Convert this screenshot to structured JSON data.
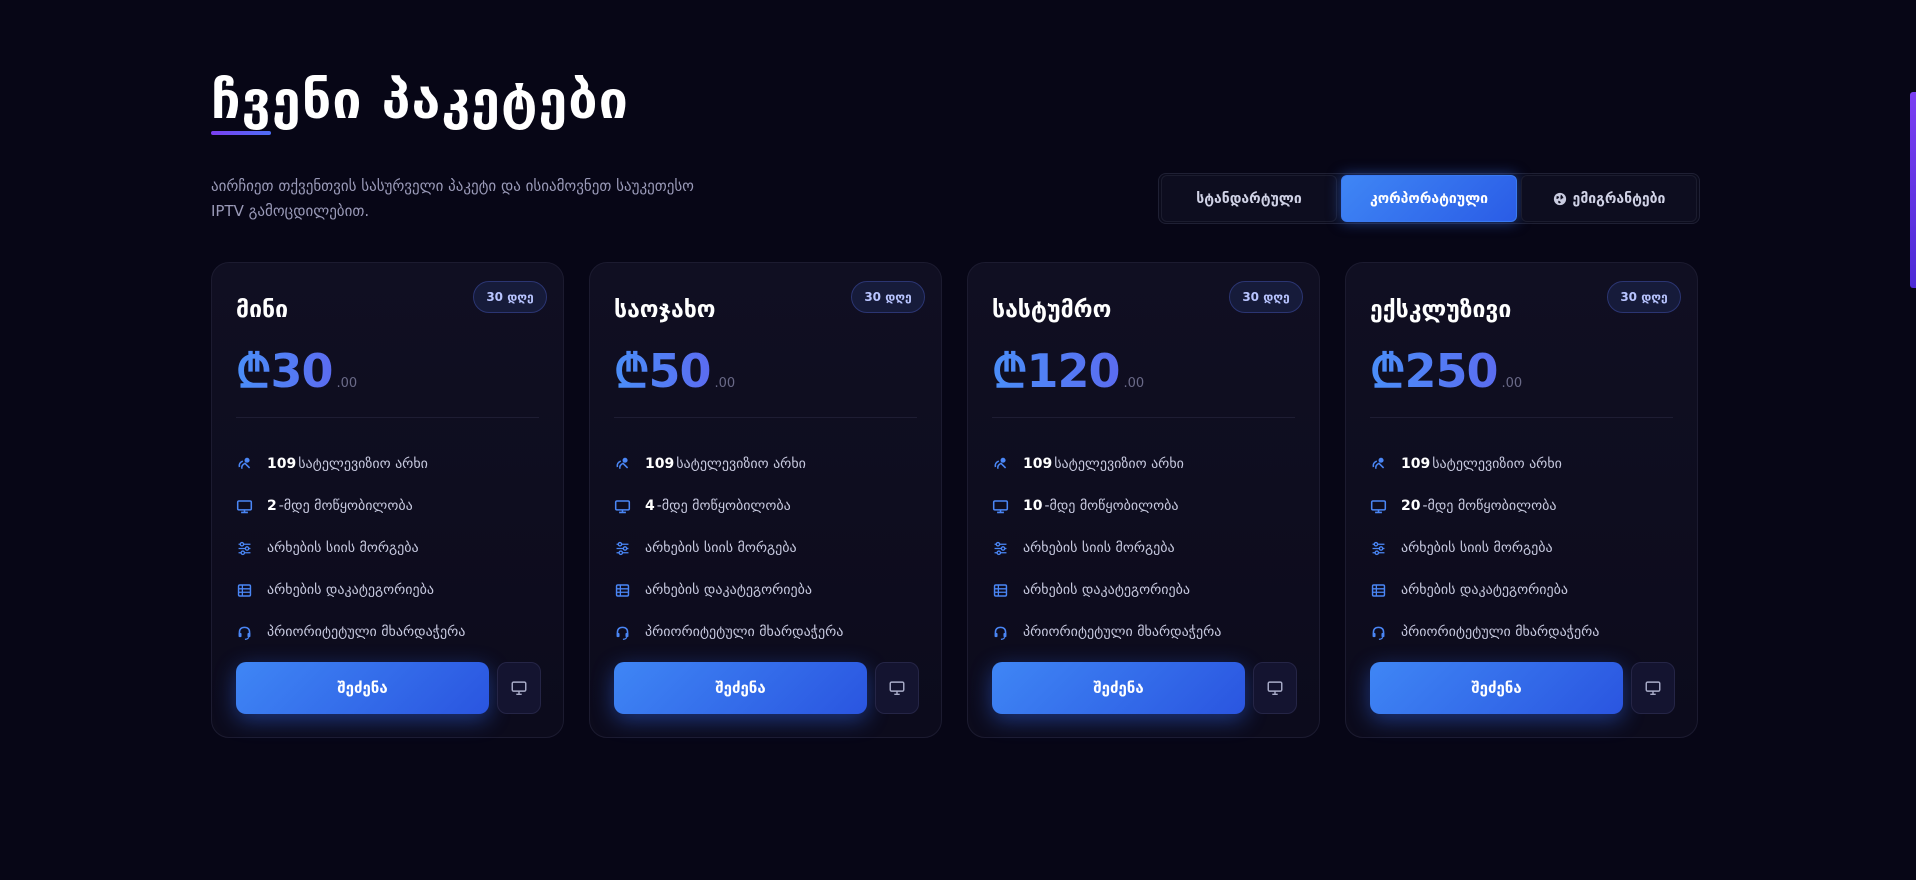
{
  "header": {
    "title": "ჩვენი პაკეტები",
    "subtitle": "აირჩიეთ თქვენთვის სასურველი პაკეტი და ისიამოვნეთ საუკეთესო IPTV გამოცდილებით."
  },
  "tabs": [
    {
      "label": "სტანდარტული",
      "active": false
    },
    {
      "label": "კორპორატიული",
      "active": true
    },
    {
      "label": "ემიგრანტები",
      "active": false,
      "icon": "globe-icon"
    }
  ],
  "colors": {
    "accent": "#3f86f5",
    "background": "#070616",
    "badge": "#161b3a",
    "purple": "#7b3ff2"
  },
  "plans": [
    {
      "name": "მინი",
      "badge": "30 დღე",
      "price": "₾30",
      "cents": ".00",
      "features": [
        {
          "icon": "satellite-icon",
          "bold": "109",
          "text": "სატელევიზიო არხი"
        },
        {
          "icon": "monitor-icon",
          "bold": "2",
          "text": "-მდე მოწყობილობა"
        },
        {
          "icon": "sliders-icon",
          "bold": "",
          "text": "არხების სიის მორგება"
        },
        {
          "icon": "table-icon",
          "bold": "",
          "text": "არხების დაკატეგორიება"
        },
        {
          "icon": "headset-icon",
          "bold": "",
          "text": "პრიორიტეტული მხარდაჭერა"
        }
      ],
      "buy_label": "შეძენა"
    },
    {
      "name": "საოჯახო",
      "badge": "30 დღე",
      "price": "₾50",
      "cents": ".00",
      "features": [
        {
          "icon": "satellite-icon",
          "bold": "109",
          "text": "სატელევიზიო არხი"
        },
        {
          "icon": "monitor-icon",
          "bold": "4",
          "text": "-მდე მოწყობილობა"
        },
        {
          "icon": "sliders-icon",
          "bold": "",
          "text": "არხების სიის მორგება"
        },
        {
          "icon": "table-icon",
          "bold": "",
          "text": "არხების დაკატეგორიება"
        },
        {
          "icon": "headset-icon",
          "bold": "",
          "text": "პრიორიტეტული მხარდაჭერა"
        }
      ],
      "buy_label": "შეძენა"
    },
    {
      "name": "სასტუმრო",
      "badge": "30 დღე",
      "price": "₾120",
      "cents": ".00",
      "features": [
        {
          "icon": "satellite-icon",
          "bold": "109",
          "text": "სატელევიზიო არხი"
        },
        {
          "icon": "monitor-icon",
          "bold": "10",
          "text": "-მდე მოწყობილობა"
        },
        {
          "icon": "sliders-icon",
          "bold": "",
          "text": "არხების სიის მორგება"
        },
        {
          "icon": "table-icon",
          "bold": "",
          "text": "არხების დაკატეგორიება"
        },
        {
          "icon": "headset-icon",
          "bold": "",
          "text": "პრიორიტეტული მხარდაჭერა"
        }
      ],
      "buy_label": "შეძენა"
    },
    {
      "name": "ექსკლუზივი",
      "badge": "30 დღე",
      "price": "₾250",
      "cents": ".00",
      "features": [
        {
          "icon": "satellite-icon",
          "bold": "109",
          "text": "სატელევიზიო არხი"
        },
        {
          "icon": "monitor-icon",
          "bold": "20",
          "text": "-მდე მოწყობილობა"
        },
        {
          "icon": "sliders-icon",
          "bold": "",
          "text": "არხების სიის მორგება"
        },
        {
          "icon": "table-icon",
          "bold": "",
          "text": "არხების დაკატეგორიება"
        },
        {
          "icon": "headset-icon",
          "bold": "",
          "text": "პრიორიტეტული მხარდაჭერა"
        }
      ],
      "buy_label": "შეძენა"
    }
  ]
}
